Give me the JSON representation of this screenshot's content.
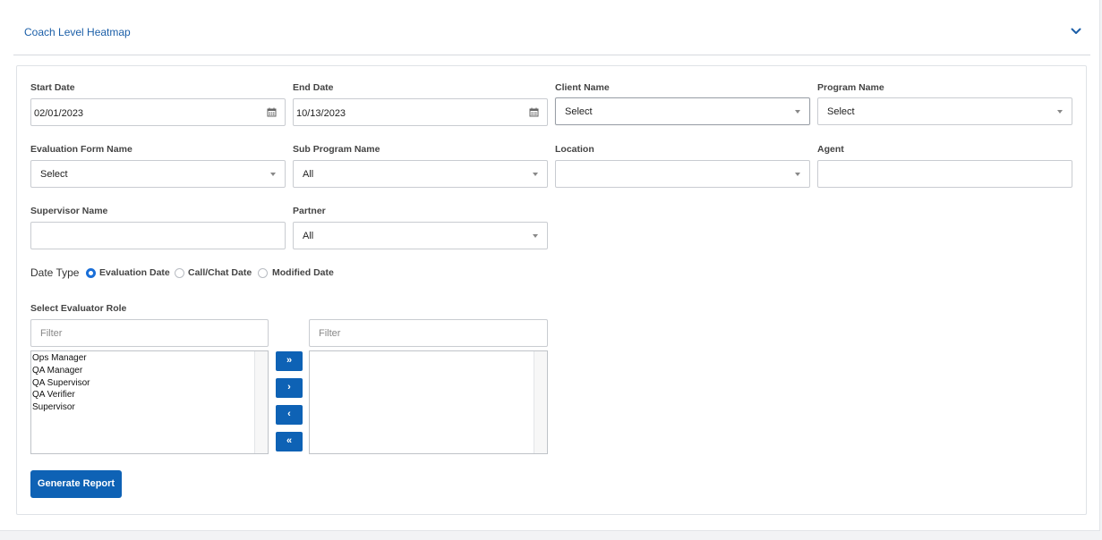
{
  "panel": {
    "title": "Coach Level Heatmap"
  },
  "fields": {
    "start_date": {
      "label": "Start Date",
      "value": "02/01/2023"
    },
    "end_date": {
      "label": "End Date",
      "value": "10/13/2023"
    },
    "client_name": {
      "label": "Client Name",
      "value": "Select"
    },
    "program_name": {
      "label": "Program Name",
      "value": "Select"
    },
    "evaluation_form_name": {
      "label": "Evaluation Form Name",
      "value": "Select"
    },
    "sub_program_name": {
      "label": "Sub Program Name",
      "value": "All"
    },
    "location": {
      "label": "Location",
      "value": ""
    },
    "agent": {
      "label": "Agent",
      "value": ""
    },
    "supervisor_name": {
      "label": "Supervisor Name",
      "value": ""
    },
    "partner": {
      "label": "Partner",
      "value": "All"
    }
  },
  "date_type": {
    "label": "Date Type",
    "options": [
      "Evaluation Date",
      "Call/Chat Date",
      "Modified Date"
    ],
    "selected": "Evaluation Date"
  },
  "evaluator_role": {
    "label": "Select Evaluator Role",
    "left_filter_placeholder": "Filter",
    "right_filter_placeholder": "Filter",
    "available": [
      "Ops Manager",
      "QA Manager",
      "QA Supervisor",
      "QA Verifier",
      "Supervisor"
    ],
    "selected": [],
    "buttons": {
      "move_all_right": "»",
      "move_right": "›",
      "move_left": "‹",
      "move_all_left": "«"
    }
  },
  "actions": {
    "generate_report": "Generate Report"
  },
  "colors": {
    "accent": "#0e62b5",
    "title": "#1c5fa8",
    "radio": "#1a6fd8"
  },
  "icons": {
    "collapse": "chevron-down-icon",
    "date": "calendar-icon",
    "dropdown": "caret-down-icon"
  }
}
